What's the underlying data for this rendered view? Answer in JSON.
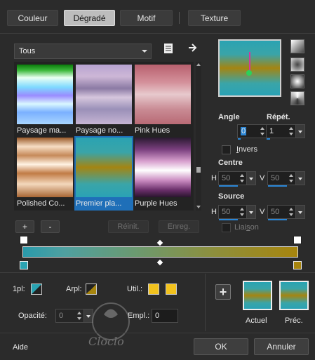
{
  "tabs": [
    {
      "label": "Couleur",
      "active": false
    },
    {
      "label": "Dégradé",
      "active": true
    },
    {
      "label": "Motif",
      "active": false
    },
    {
      "label": "Texture",
      "active": false
    }
  ],
  "category_select": {
    "value": "Tous"
  },
  "gradients": [
    {
      "label": "Paysage ma...",
      "selected": false
    },
    {
      "label": "Paysage no...",
      "selected": false
    },
    {
      "label": "Pink Hues",
      "selected": false
    },
    {
      "label": "Polished Co...",
      "selected": false
    },
    {
      "label": "Premier pla...",
      "selected": true
    },
    {
      "label": "Purple Hues",
      "selected": false
    }
  ],
  "library_buttons": {
    "add": "+",
    "remove": "-",
    "reset": "Réinit.",
    "save": "Enreg."
  },
  "angle": {
    "label": "Angle",
    "value": "0"
  },
  "repeat": {
    "label": "Répét.",
    "value": "1"
  },
  "invert": {
    "label": "Invers",
    "checked": false
  },
  "center": {
    "label": "Centre",
    "h_label": "H",
    "h_value": "50",
    "v_label": "V",
    "v_value": "50"
  },
  "source": {
    "label": "Source",
    "h_label": "H",
    "h_value": "50",
    "v_label": "V",
    "v_value": "50"
  },
  "link": {
    "label": "Liaison",
    "checked": false
  },
  "stops": {
    "pl_label": "1pl:",
    "arpl_label": "Arpl:",
    "util_label": "Util.:",
    "opacity_label": "Opacité:",
    "opacity_value": "0",
    "location_label": "Empl.:",
    "location_value": "0"
  },
  "preview": {
    "current_label": "Actuel",
    "previous_label": "Préc.",
    "add": "+"
  },
  "footer": {
    "help": "Aide",
    "ok": "OK",
    "cancel": "Annuler"
  },
  "colors": {
    "accent": "#2a86d6",
    "teal": "#2aa3b2",
    "gold": "#a7850e",
    "yellow": "#f2c21d"
  }
}
